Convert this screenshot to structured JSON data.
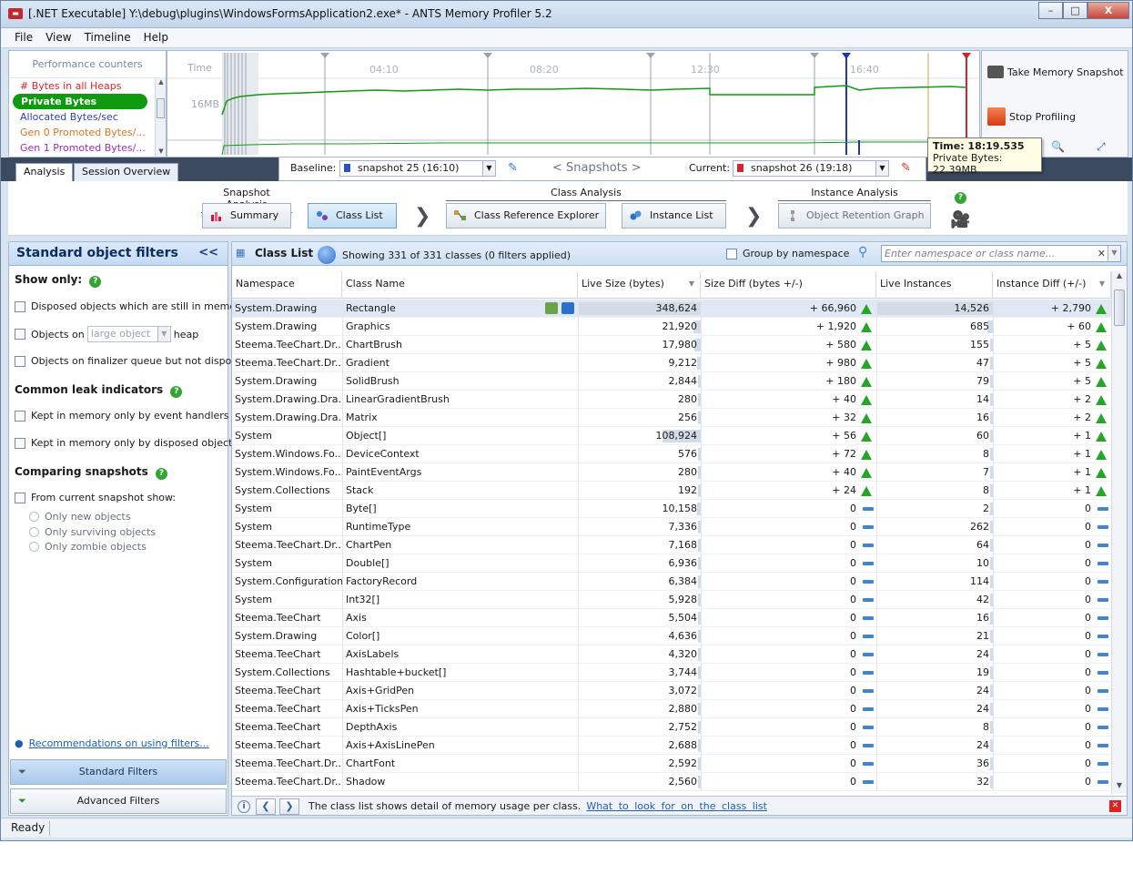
{
  "window": {
    "title": "[.NET Executable] Y:\\debug\\plugins\\WindowsFormsApplication2.exe* - ANTS Memory Profiler 5.2",
    "minimize": "–",
    "maximize": "□",
    "close": "X"
  },
  "menu": [
    "File",
    "View",
    "Timeline",
    "Help"
  ],
  "perf_counters": {
    "title": "Performance counters",
    "items": [
      {
        "label": "# Bytes in all Heaps",
        "color": "#d8262b",
        "selected": false
      },
      {
        "label": "Private Bytes",
        "color": "#ffffff",
        "selected": true
      },
      {
        "label": "Allocated Bytes/sec",
        "color": "#2d3fb5",
        "selected": false
      },
      {
        "label": "Gen 0 Promoted Bytes/...",
        "color": "#d67718",
        "selected": false
      },
      {
        "label": "Gen 1 Promoted Bytes/...",
        "color": "#9b2fa8",
        "selected": false
      }
    ]
  },
  "timeline": {
    "time_label": "Time",
    "y_label": "16MB",
    "ticks": [
      "04:10",
      "08:20",
      "12:30",
      "16:40"
    ]
  },
  "timeline_side": {
    "take_snapshot": "Take Memory Snapshot",
    "stop_profiling": "Stop Profiling"
  },
  "tooltip": {
    "time": "Time: 18:19.535",
    "value": "Private Bytes: 22.39MB"
  },
  "tabs": [
    "Analysis",
    "Session Overview"
  ],
  "snapshots": {
    "baseline_label": "Baseline:",
    "baseline_value": "snapshot 25 (16:10)",
    "baseline_color": "#2d4fbf",
    "nav": "< Snapshots >",
    "current_label": "Current:",
    "current_value": "snapshot 26 (19:18)",
    "current_color": "#d0262b"
  },
  "analysis_groups": {
    "snapshot_analysis": "Snapshot Analysis",
    "class_analysis": "Class Analysis",
    "instance_analysis": "Instance Analysis",
    "buttons": {
      "summary": "Summary",
      "class_list": "Class List",
      "class_ref": "Class Reference Explorer",
      "instance_list": "Instance List",
      "retention": "Object Retention Graph"
    }
  },
  "filters": {
    "title": "Standard object filters",
    "collapse": "<<",
    "show_only": "Show only:",
    "disposed": "Disposed objects which are still in memory",
    "objects_on": "Objects on",
    "heap_select": "large object",
    "heap": "heap",
    "finalizer": "Objects on finalizer queue but not disposed",
    "leak_indicators": "Common leak indicators",
    "event_handlers": "Kept in memory only by event handlers",
    "disposed_objects": "Kept in memory only by disposed objects",
    "comparing": "Comparing snapshots",
    "from_current": "From current snapshot show:",
    "only_new": "Only new objects",
    "only_surviving": "Only surviving objects",
    "only_zombie": "Only zombie objects",
    "recommendations": "Recommendations on using filters...",
    "standard_btn": "Standard Filters",
    "advanced_btn": "Advanced Filters"
  },
  "classlist": {
    "title": "Class List",
    "showing": "Showing 331 of 331 classes (0 filters applied)",
    "group_by_ns": "Group by namespace",
    "search_placeholder": "Enter namespace or class name...",
    "columns": {
      "namespace": "Namespace",
      "class_name": "Class Name",
      "live_size": "Live Size (bytes)",
      "size_diff": "Size Diff (bytes +/-)",
      "live_instances": "Live Instances",
      "instance_diff": "Instance Diff (+/-)"
    },
    "rows": [
      {
        "ns": "System.Drawing",
        "cls": "Rectangle",
        "ls": "348,624",
        "lsn": 348624,
        "sd": "+ 66,960",
        "li": "14,526",
        "lin": 14526,
        "id": "+ 2,790",
        "up": true
      },
      {
        "ns": "System.Drawing",
        "cls": "Graphics",
        "ls": "21,920",
        "lsn": 21920,
        "sd": "+ 1,920",
        "li": "685",
        "lin": 685,
        "id": "+ 60",
        "up": true
      },
      {
        "ns": "Steema.TeeChart.Dr...",
        "cls": "ChartBrush",
        "ls": "17,980",
        "lsn": 17980,
        "sd": "+ 580",
        "li": "155",
        "lin": 155,
        "id": "+ 5",
        "up": true
      },
      {
        "ns": "Steema.TeeChart.Dr...",
        "cls": "Gradient",
        "ls": "9,212",
        "lsn": 9212,
        "sd": "+ 980",
        "li": "47",
        "lin": 47,
        "id": "+ 5",
        "up": true
      },
      {
        "ns": "System.Drawing",
        "cls": "SolidBrush",
        "ls": "2,844",
        "lsn": 2844,
        "sd": "+ 180",
        "li": "79",
        "lin": 79,
        "id": "+ 5",
        "up": true
      },
      {
        "ns": "System.Drawing.Dra...",
        "cls": "LinearGradientBrush",
        "ls": "280",
        "lsn": 280,
        "sd": "+ 40",
        "li": "14",
        "lin": 14,
        "id": "+ 2",
        "up": true
      },
      {
        "ns": "System.Drawing.Dra...",
        "cls": "Matrix",
        "ls": "256",
        "lsn": 256,
        "sd": "+ 32",
        "li": "16",
        "lin": 16,
        "id": "+ 2",
        "up": true
      },
      {
        "ns": "System",
        "cls": "Object[]",
        "ls": "108,924",
        "lsn": 108924,
        "sd": "+ 56",
        "li": "60",
        "lin": 60,
        "id": "+ 1",
        "up": true
      },
      {
        "ns": "System.Windows.Fo...",
        "cls": "DeviceContext",
        "ls": "576",
        "lsn": 576,
        "sd": "+ 72",
        "li": "8",
        "lin": 8,
        "id": "+ 1",
        "up": true
      },
      {
        "ns": "System.Windows.Fo...",
        "cls": "PaintEventArgs",
        "ls": "280",
        "lsn": 280,
        "sd": "+ 40",
        "li": "7",
        "lin": 7,
        "id": "+ 1",
        "up": true
      },
      {
        "ns": "System.Collections",
        "cls": "Stack",
        "ls": "192",
        "lsn": 192,
        "sd": "+ 24",
        "li": "8",
        "lin": 8,
        "id": "+ 1",
        "up": true
      },
      {
        "ns": "System",
        "cls": "Byte[]",
        "ls": "10,158",
        "lsn": 10158,
        "sd": "0",
        "li": "2",
        "lin": 2,
        "id": "0",
        "up": false
      },
      {
        "ns": "System",
        "cls": "RuntimeType",
        "ls": "7,336",
        "lsn": 7336,
        "sd": "0",
        "li": "262",
        "lin": 262,
        "id": "0",
        "up": false
      },
      {
        "ns": "Steema.TeeChart.Dr...",
        "cls": "ChartPen",
        "ls": "7,168",
        "lsn": 7168,
        "sd": "0",
        "li": "64",
        "lin": 64,
        "id": "0",
        "up": false
      },
      {
        "ns": "System",
        "cls": "Double[]",
        "ls": "6,936",
        "lsn": 6936,
        "sd": "0",
        "li": "10",
        "lin": 10,
        "id": "0",
        "up": false
      },
      {
        "ns": "System.Configuration",
        "cls": "FactoryRecord",
        "ls": "6,384",
        "lsn": 6384,
        "sd": "0",
        "li": "114",
        "lin": 114,
        "id": "0",
        "up": false
      },
      {
        "ns": "System",
        "cls": "Int32[]",
        "ls": "5,928",
        "lsn": 5928,
        "sd": "0",
        "li": "42",
        "lin": 42,
        "id": "0",
        "up": false
      },
      {
        "ns": "Steema.TeeChart",
        "cls": "Axis",
        "ls": "5,504",
        "lsn": 5504,
        "sd": "0",
        "li": "16",
        "lin": 16,
        "id": "0",
        "up": false
      },
      {
        "ns": "System.Drawing",
        "cls": "Color[]",
        "ls": "4,636",
        "lsn": 4636,
        "sd": "0",
        "li": "21",
        "lin": 21,
        "id": "0",
        "up": false
      },
      {
        "ns": "Steema.TeeChart",
        "cls": "AxisLabels",
        "ls": "4,320",
        "lsn": 4320,
        "sd": "0",
        "li": "24",
        "lin": 24,
        "id": "0",
        "up": false
      },
      {
        "ns": "System.Collections",
        "cls": "Hashtable+bucket[]",
        "ls": "3,744",
        "lsn": 3744,
        "sd": "0",
        "li": "19",
        "lin": 19,
        "id": "0",
        "up": false
      },
      {
        "ns": "Steema.TeeChart",
        "cls": "Axis+GridPen",
        "ls": "3,072",
        "lsn": 3072,
        "sd": "0",
        "li": "24",
        "lin": 24,
        "id": "0",
        "up": false
      },
      {
        "ns": "Steema.TeeChart",
        "cls": "Axis+TicksPen",
        "ls": "2,880",
        "lsn": 2880,
        "sd": "0",
        "li": "24",
        "lin": 24,
        "id": "0",
        "up": false
      },
      {
        "ns": "Steema.TeeChart",
        "cls": "DepthAxis",
        "ls": "2,752",
        "lsn": 2752,
        "sd": "0",
        "li": "8",
        "lin": 8,
        "id": "0",
        "up": false
      },
      {
        "ns": "Steema.TeeChart",
        "cls": "Axis+AxisLinePen",
        "ls": "2,688",
        "lsn": 2688,
        "sd": "0",
        "li": "24",
        "lin": 24,
        "id": "0",
        "up": false
      },
      {
        "ns": "Steema.TeeChart.Dr...",
        "cls": "ChartFont",
        "ls": "2,592",
        "lsn": 2592,
        "sd": "0",
        "li": "36",
        "lin": 36,
        "id": "0",
        "up": false
      },
      {
        "ns": "Steema.TeeChart.Dr...",
        "cls": "Shadow",
        "ls": "2,560",
        "lsn": 2560,
        "sd": "0",
        "li": "32",
        "lin": 32,
        "id": "0",
        "up": false
      }
    ]
  },
  "infobar": {
    "text": "The class list shows detail of memory usage per class.",
    "link": "What to look for on the class list"
  },
  "status": "Ready"
}
